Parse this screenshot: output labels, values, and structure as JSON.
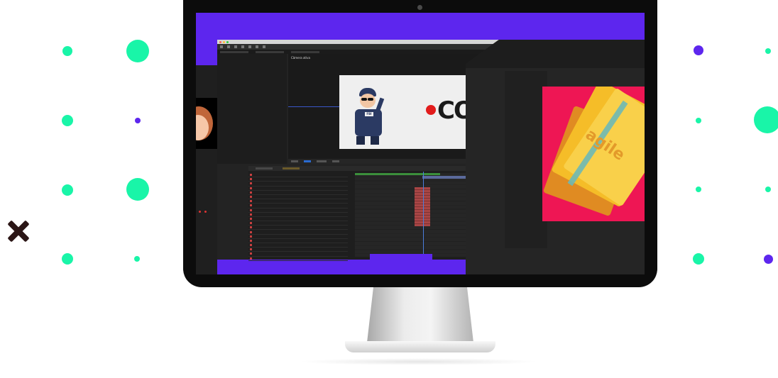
{
  "colors": {
    "accent_mint": "#19f5a8",
    "accent_violet": "#5d26ee",
    "cross": "#2b1616",
    "screen_bg": "#5d26ee",
    "ae_panel": "#232323",
    "art_red": "#ee1654",
    "art_yellow": "#f5bd28"
  },
  "decor": {
    "left_dots": [
      "mint",
      "mint",
      "mint",
      "violet",
      "mint",
      "mint",
      "mint",
      "mint"
    ],
    "right_dots": [
      "violet",
      "mint",
      "mint",
      "mint",
      "mint",
      "mint",
      "mint",
      "violet"
    ],
    "cross_icon": "close-icon"
  },
  "screen": {
    "app_window": {
      "viewer_label": "Câmera ativa",
      "canvas_text": "CO",
      "badge_text": "FBI",
      "tabs": [
        "Composição",
        "Timeline"
      ],
      "layer_count": 20
    },
    "right_window": {
      "art_text": "agile"
    }
  }
}
